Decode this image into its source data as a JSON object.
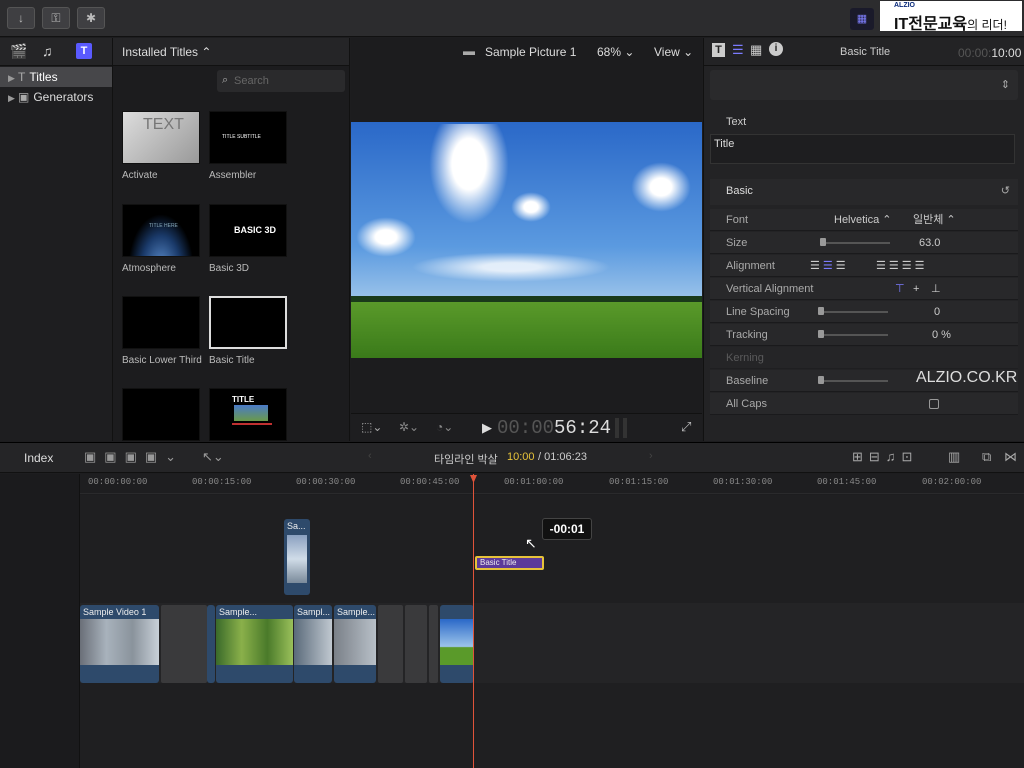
{
  "toolbar": {
    "btn1": "↓",
    "btn2": "⚿",
    "btn3": "✱"
  },
  "brand": {
    "small": "ALZIO",
    "main": "IT전문교육",
    "suffix": "의 리더!"
  },
  "library": {
    "items": [
      {
        "label": "Titles",
        "selected": true
      },
      {
        "label": "Generators",
        "selected": false
      }
    ]
  },
  "browser": {
    "header": "Installed Titles",
    "search_placeholder": "Search",
    "items": [
      {
        "label": "Activate",
        "thumb_text": "TEXT"
      },
      {
        "label": "Assembler",
        "thumb_text": "TITLE SUBTITLE"
      },
      {
        "label": "Atmosphere",
        "thumb_text": "TITLE HERE"
      },
      {
        "label": "Basic 3D",
        "thumb_text": "BASIC 3D"
      },
      {
        "label": "Basic Lower Third",
        "thumb_text": ""
      },
      {
        "label": "Basic Title",
        "thumb_text": ""
      },
      {
        "label": "",
        "thumb_text": ""
      },
      {
        "label": "",
        "thumb_text": "TITLE"
      }
    ]
  },
  "viewer": {
    "title": "Sample Picture 1",
    "zoom": "68%",
    "view_label": "View",
    "timecode_dim": "00:00",
    "timecode": "56:24"
  },
  "inspector": {
    "title": "Basic Title",
    "time_dim": "00:00:",
    "time": "10:00",
    "text_section": "Text",
    "text_value": "Title",
    "basic_section": "Basic",
    "rows": [
      {
        "label": "Font",
        "value": "Helvetica ⌃",
        "value2": "일반체 ⌃"
      },
      {
        "label": "Size",
        "value": "63.0"
      },
      {
        "label": "Alignment",
        "value": ""
      },
      {
        "label": "Vertical Alignment",
        "value": ""
      },
      {
        "label": "Line Spacing",
        "value": "0"
      },
      {
        "label": "Tracking",
        "value": "0 %"
      },
      {
        "label": "Kerning",
        "value": ""
      },
      {
        "label": "Baseline",
        "value": ""
      },
      {
        "label": "All Caps",
        "value": ""
      }
    ],
    "watermark": "ALZIO.CO.KR"
  },
  "timeline": {
    "index_label": "Index",
    "project": "타임라인 박살",
    "current": "10:00",
    "total": "/ 01:06:23",
    "ruler": [
      "00:00:00:00",
      "00:00:15:00",
      "00:00:30:00",
      "00:00:45:00",
      "00:01:00:00",
      "00:01:15:00",
      "00:01:30:00",
      "00:01:45:00",
      "00:02:00:00"
    ],
    "tooltip": "-00:01",
    "title_clip": "Basic Title",
    "connected_clip": "Sa...",
    "clips": [
      "Sample Video 1",
      "Sample...",
      "Sampl...",
      "Sampl...",
      "Sample..."
    ]
  },
  "colors": {
    "accent": "#7b7bff",
    "playhead": "#e0533a",
    "title_clip": "#5b3a9a",
    "title_border": "#e6c23a"
  }
}
